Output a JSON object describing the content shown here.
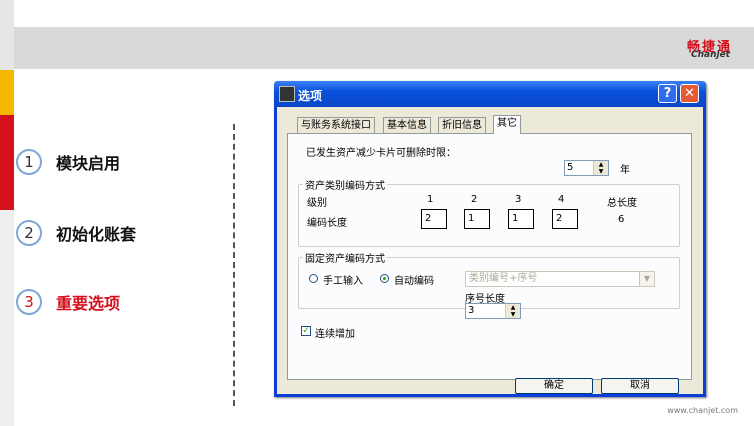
{
  "brand": {
    "logo_cn": "畅捷通",
    "logo_en": "Chanjet",
    "website": "www.chanjet.com",
    "colors": {
      "accent_red": "#d4101c",
      "accent_yellow": "#f5b800",
      "circle_border": "#7fa6d8"
    }
  },
  "agenda": [
    {
      "num": "1",
      "label": "模块启用",
      "active": false
    },
    {
      "num": "2",
      "label": "初始化账套",
      "active": false
    },
    {
      "num": "3",
      "label": "重要选项",
      "active": true
    }
  ],
  "dialog": {
    "title": "选项",
    "help_label": "?",
    "close_label": "✕",
    "tabs": [
      "与账务系统接口",
      "基本信息",
      "折旧信息",
      "其它"
    ],
    "active_tab": "其它",
    "delete_limit_label": "已发生资产减少卡片可删除时限：",
    "delete_limit_value": "5",
    "delete_limit_unit": "年",
    "category_group": {
      "title": "资产类别编码方式",
      "level_label": "级别",
      "levels": [
        "1",
        "2",
        "3",
        "4"
      ],
      "total_label": "总长度",
      "length_label": "编码长度",
      "lengths": [
        "2",
        "1",
        "1",
        "2"
      ],
      "total_value": "6"
    },
    "fixed_group": {
      "title": "固定资产编码方式",
      "manual_label": "手工输入",
      "auto_label": "自动编码",
      "selected": "auto",
      "combo_value": "类别编号+序号",
      "seq_length_label": "序号长度",
      "seq_length_value": "3"
    },
    "continuous_add_label": "连续增加",
    "continuous_add_checked": true,
    "ok_label": "确定",
    "cancel_label": "取消"
  }
}
